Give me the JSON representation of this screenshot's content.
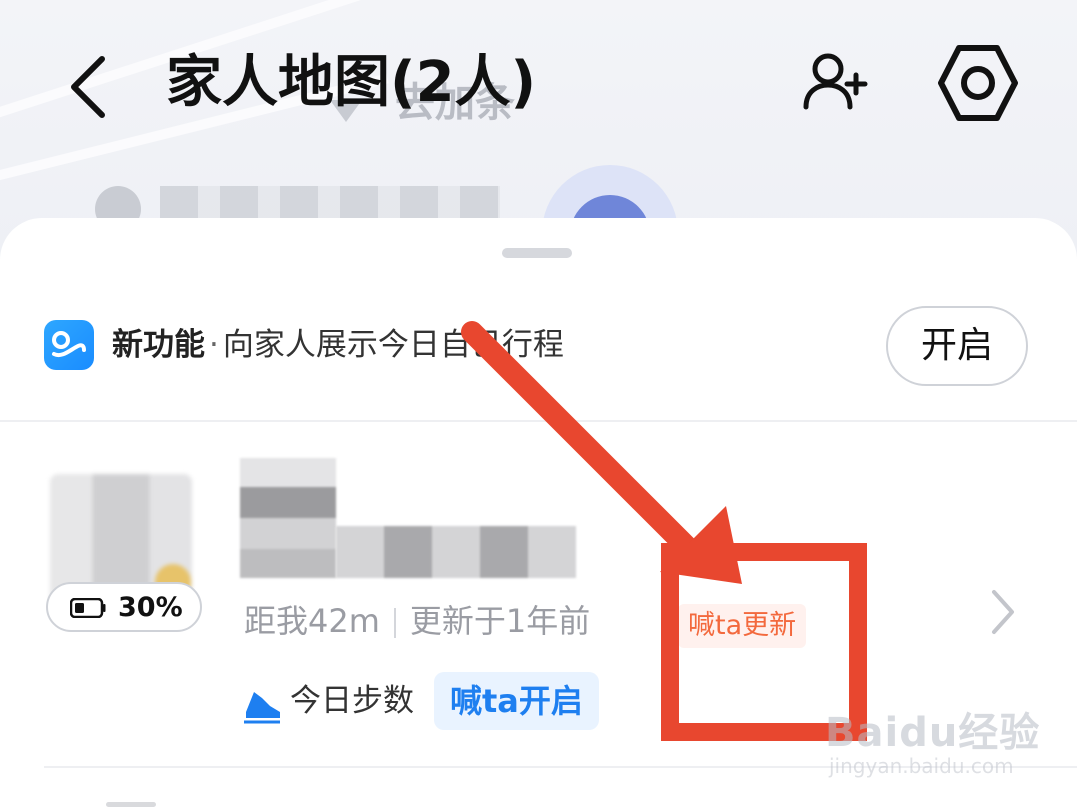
{
  "header": {
    "title": "家人地图(2人)",
    "back_icon": "chevron-left-icon",
    "add_member_icon": "add-person-icon",
    "settings_icon": "hexagon-settings-icon"
  },
  "map": {
    "label_partial": "去加条"
  },
  "feature_banner": {
    "icon": "route-icon",
    "title": "新功能",
    "separator": "·",
    "description": "向家人展示今日自己行程",
    "button_label": "开启"
  },
  "member": {
    "battery_percent": "30%",
    "distance": "距我42m",
    "updated": "更新于1年前",
    "ping_update_label": "喊ta更新",
    "steps_label": "今日步数",
    "ping_steps_label": "喊ta开启"
  },
  "watermark": {
    "logo": "Baidu经验",
    "url": "jingyan.baidu.com"
  },
  "colors": {
    "annotation_red": "#e8472f",
    "accent_blue": "#1e7ff0",
    "ping_orange": "#f3693d"
  }
}
